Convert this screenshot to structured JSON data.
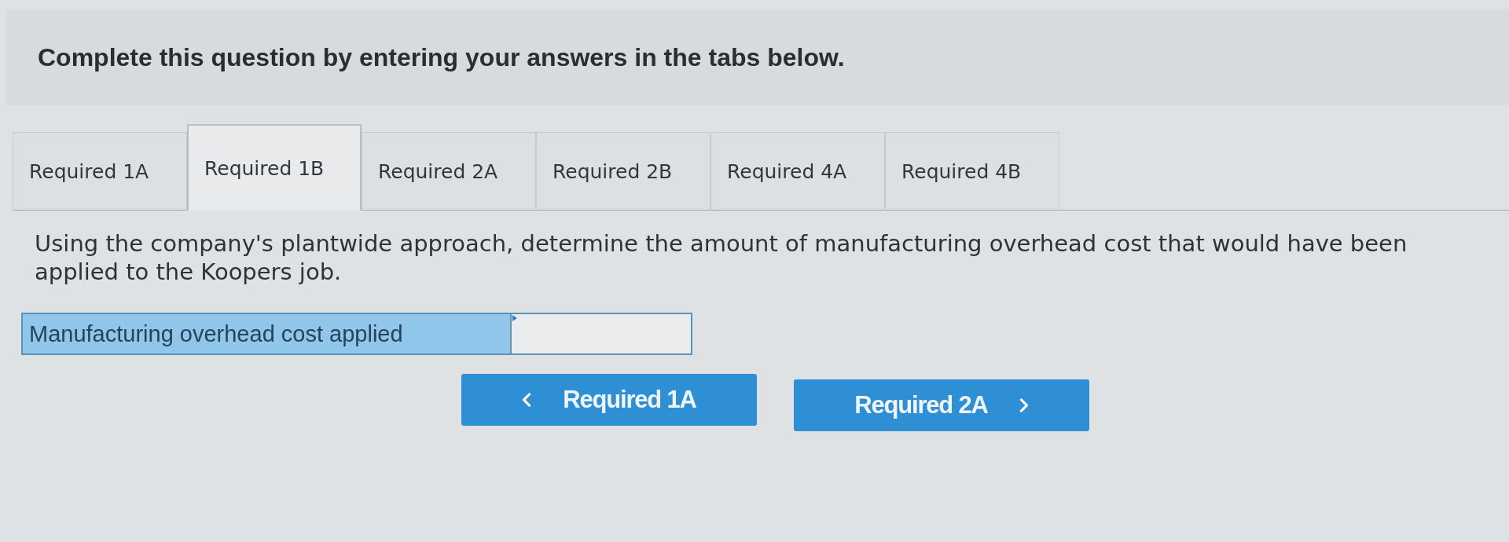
{
  "instruction": "Complete this question by entering your answers in the tabs below.",
  "tabs": [
    {
      "label": "Required 1A",
      "selected": false
    },
    {
      "label": "Required 1B",
      "selected": true
    },
    {
      "label": "Required 2A",
      "selected": false
    },
    {
      "label": "Required 2B",
      "selected": false
    },
    {
      "label": "Required 4A",
      "selected": false
    },
    {
      "label": "Required 4B",
      "selected": false
    }
  ],
  "question": "Using the company's plantwide approach, determine the amount of manufacturing overhead cost that would have been applied to the Koopers job.",
  "answer_row": {
    "label": "Manufacturing overhead cost applied"
  },
  "nav_buttons": [
    {
      "label": "Required 1A",
      "kind": "previous"
    },
    {
      "label": "Required 2A",
      "kind": "next"
    }
  ]
}
